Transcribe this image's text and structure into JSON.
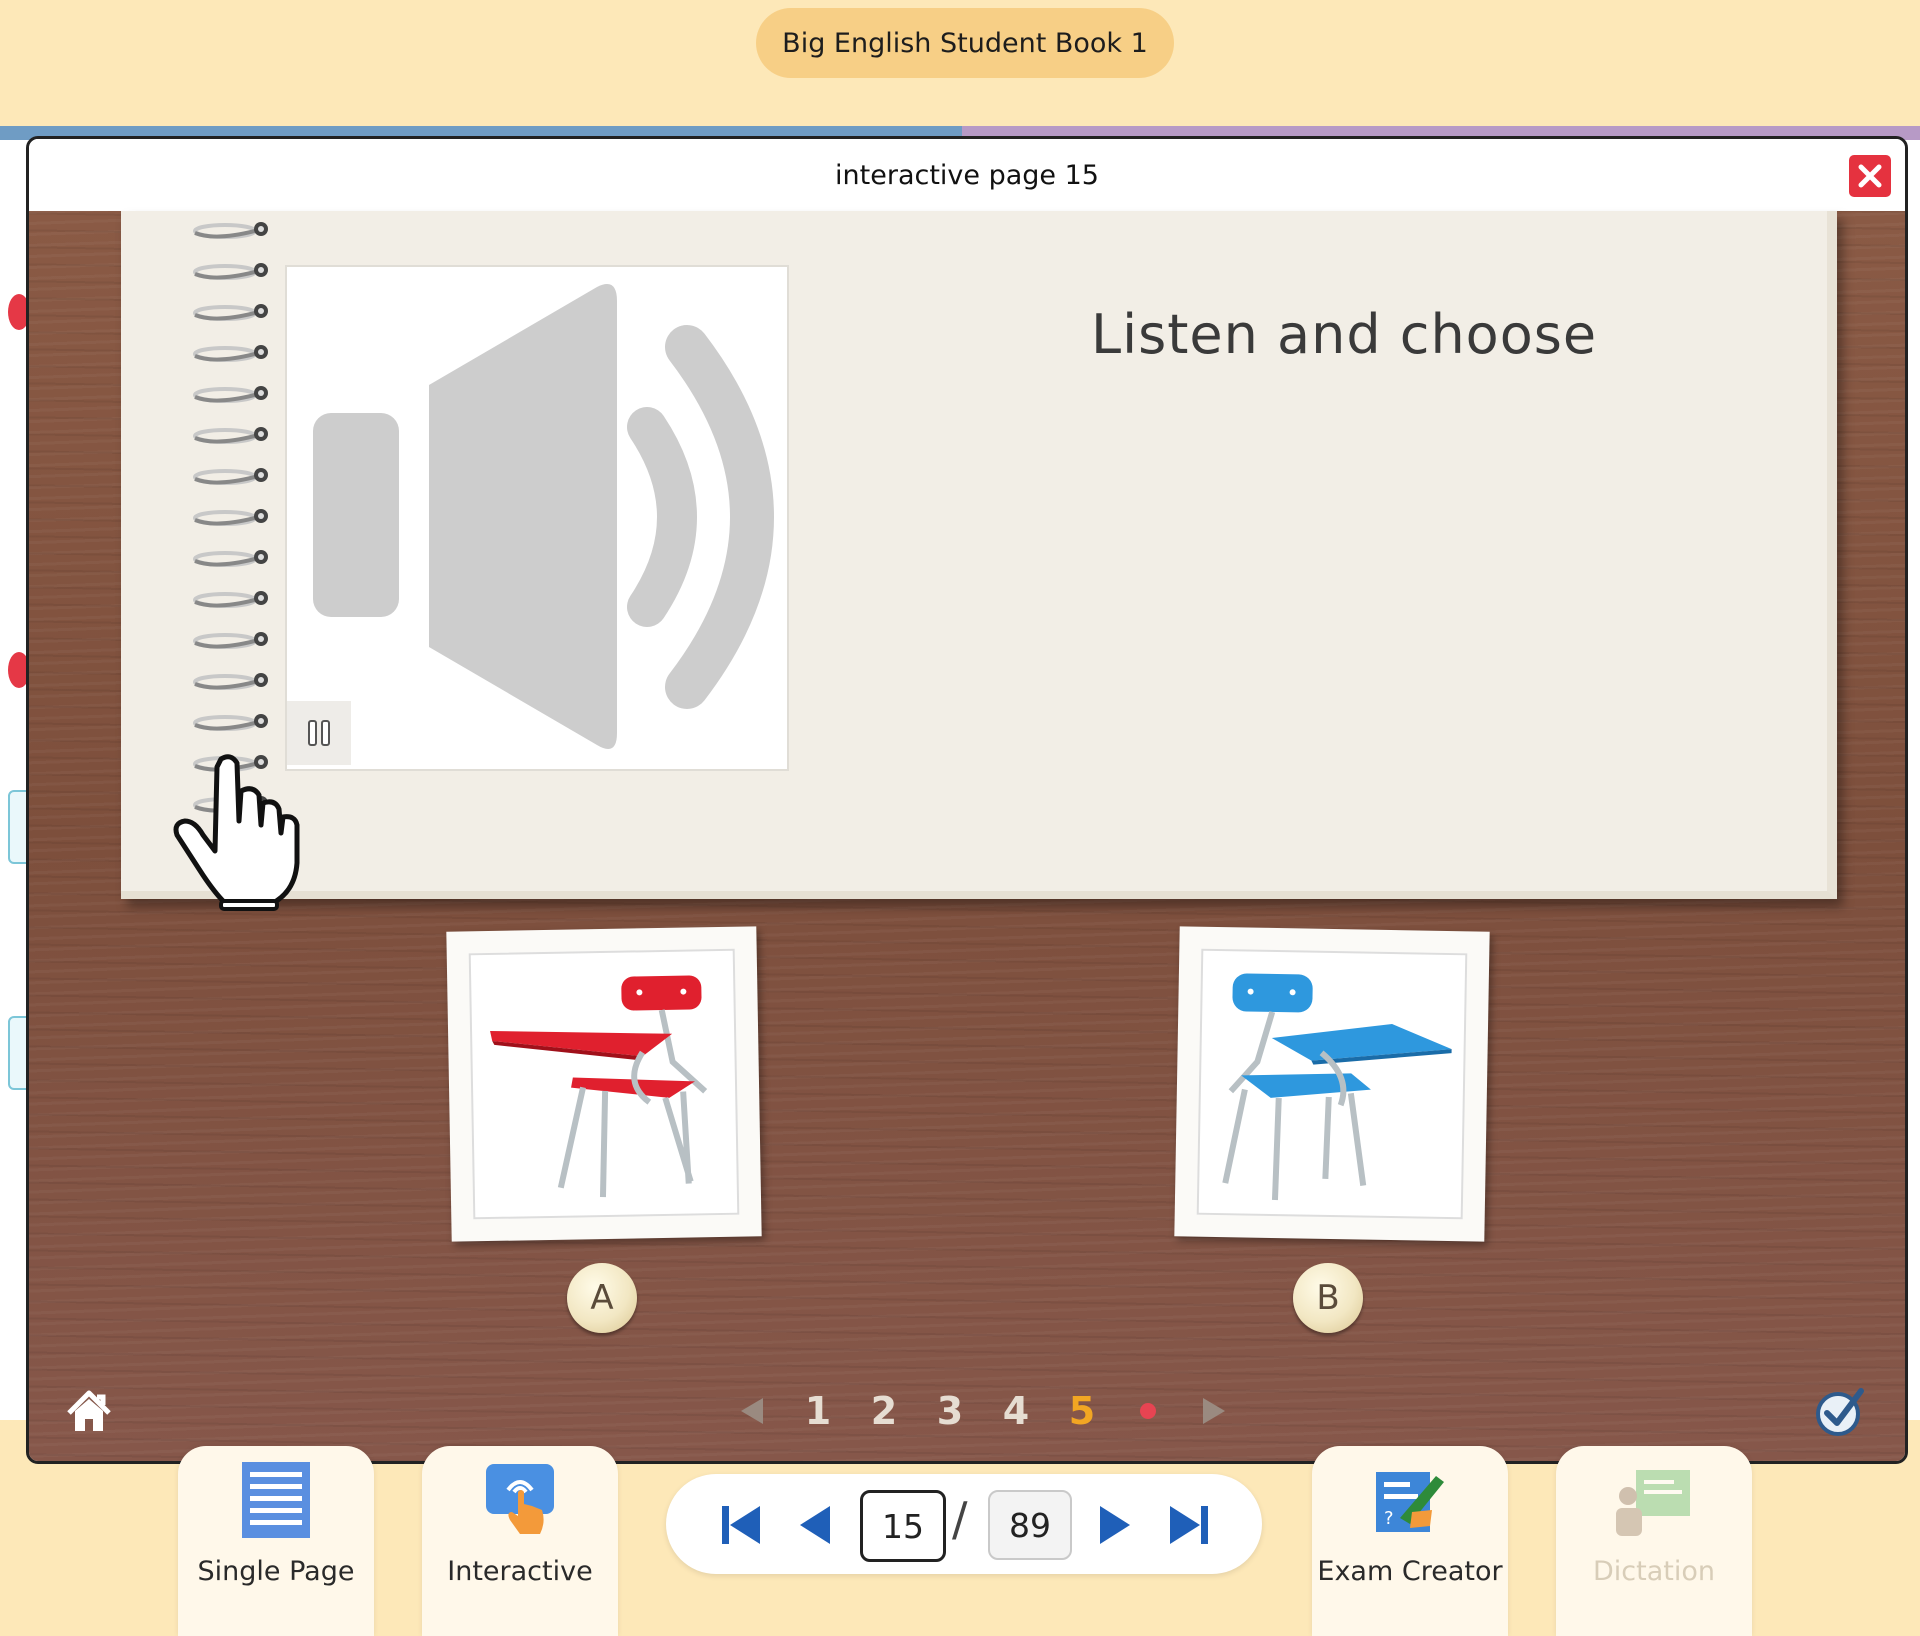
{
  "app": {
    "title": "Big English Student Book 1"
  },
  "modal": {
    "title": "interactive page 15"
  },
  "activity": {
    "instruction": "Listen and choose",
    "choices": [
      {
        "letter": "A",
        "image": "red-school-desk-chair"
      },
      {
        "letter": "B",
        "image": "blue-school-desk-chair"
      }
    ]
  },
  "pager": {
    "pages": [
      "1",
      "2",
      "3",
      "4",
      "5"
    ],
    "active_index": 4,
    "accent": "#f2a623",
    "dot_color": "#e74452"
  },
  "toolbar": {
    "single_page_label": "Single Page",
    "interactive_label": "Interactive",
    "exam_creator_label": "Exam Creator",
    "dictation_label": "Dictation",
    "current_page": "15",
    "page_separator": "/",
    "total_pages": "89"
  },
  "colors": {
    "nav_blue": "#1f5fb8",
    "close_red": "#e5323f",
    "header_bg": "#fde8b8"
  }
}
